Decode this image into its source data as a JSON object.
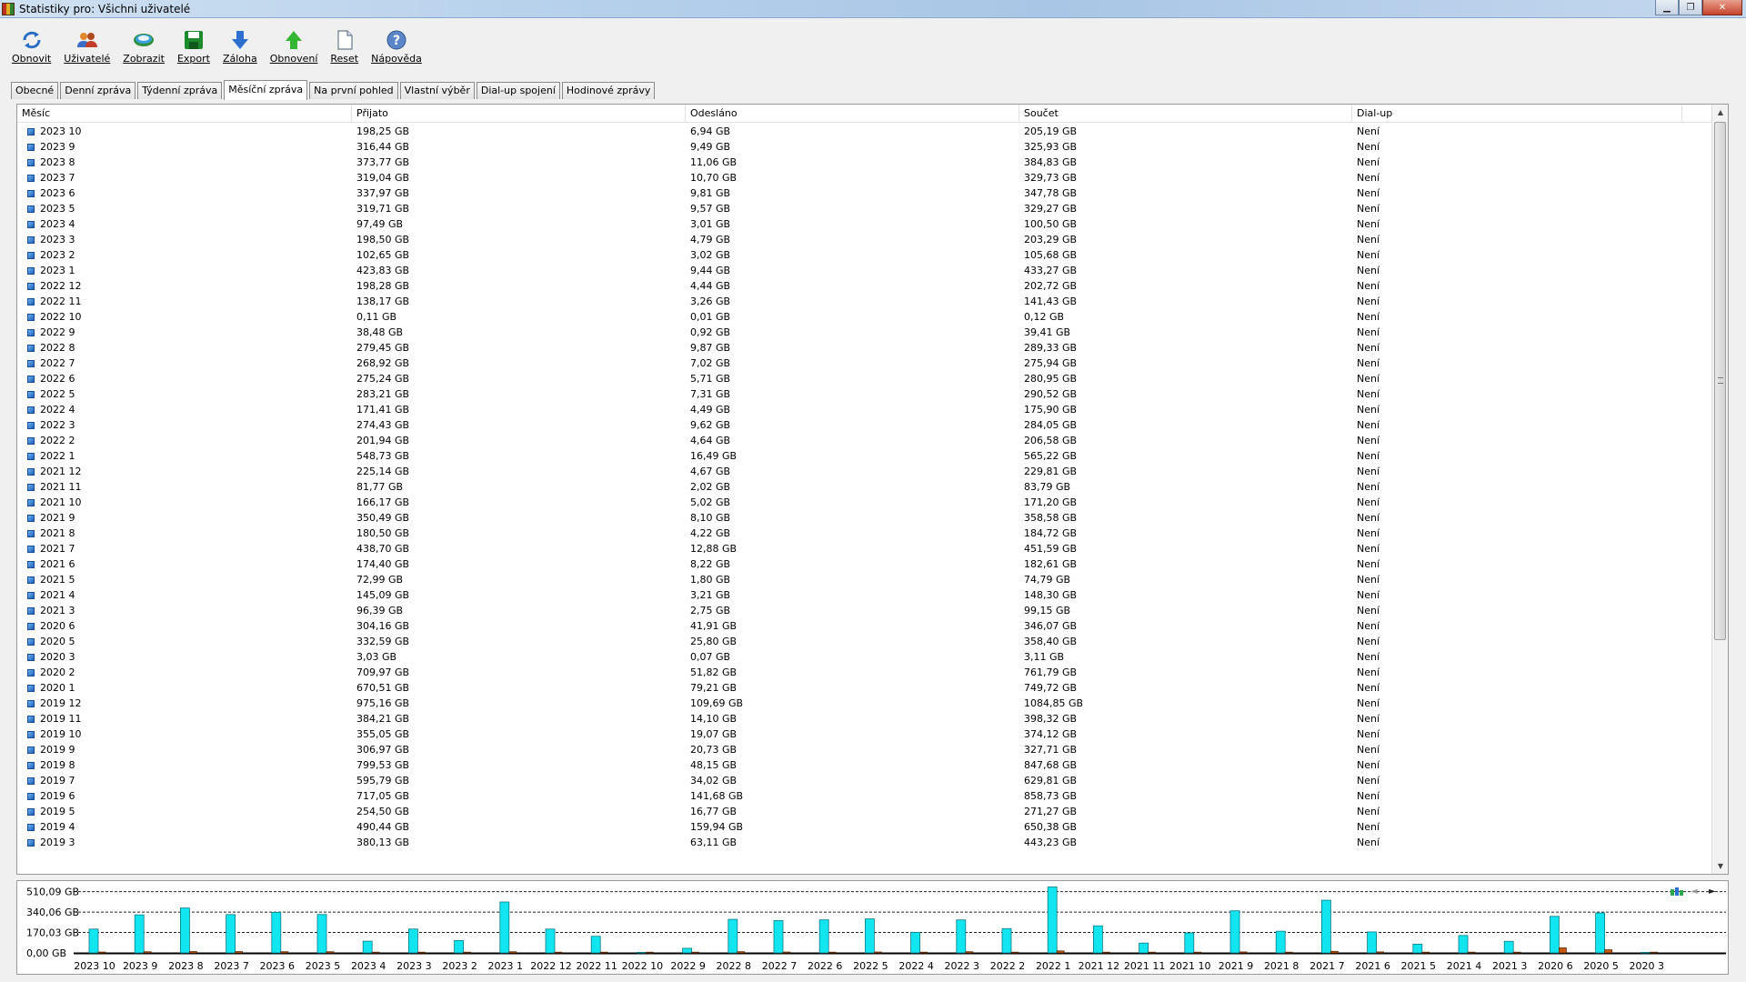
{
  "window": {
    "title": "Statistiky pro: Všichni uživatelé"
  },
  "toolbar": [
    {
      "label": "Obnovit",
      "icon": "refresh-icon"
    },
    {
      "label": "Uživatelé",
      "icon": "users-icon"
    },
    {
      "label": "Zobrazit",
      "icon": "view-icon"
    },
    {
      "label": "Export",
      "icon": "save-icon"
    },
    {
      "label": "Záloha",
      "icon": "arrow-down-icon"
    },
    {
      "label": "Obnovení",
      "icon": "arrow-up-icon"
    },
    {
      "label": "Reset",
      "icon": "page-icon"
    },
    {
      "label": "Nápověda",
      "icon": "help-icon"
    }
  ],
  "tabs": [
    {
      "label": "Obecné",
      "active": false
    },
    {
      "label": "Denní zpráva",
      "active": false
    },
    {
      "label": "Týdenní zpráva",
      "active": false
    },
    {
      "label": "Měsíční zpráva",
      "active": true
    },
    {
      "label": "Na první pohled",
      "active": false
    },
    {
      "label": "Vlastní výběr",
      "active": false
    },
    {
      "label": "Dial-up spojení",
      "active": false
    },
    {
      "label": "Hodinové zprávy",
      "active": false
    }
  ],
  "table": {
    "columns": [
      "Měsíc",
      "Přijato",
      "Odesláno",
      "Součet",
      "Dial-up"
    ],
    "rows": [
      [
        "2023 10",
        "198,25 GB",
        "6,94 GB",
        "205,19 GB",
        "Není"
      ],
      [
        "2023 9",
        "316,44 GB",
        "9,49 GB",
        "325,93 GB",
        "Není"
      ],
      [
        "2023 8",
        "373,77 GB",
        "11,06 GB",
        "384,83 GB",
        "Není"
      ],
      [
        "2023 7",
        "319,04 GB",
        "10,70 GB",
        "329,73 GB",
        "Není"
      ],
      [
        "2023 6",
        "337,97 GB",
        "9,81 GB",
        "347,78 GB",
        "Není"
      ],
      [
        "2023 5",
        "319,71 GB",
        "9,57 GB",
        "329,27 GB",
        "Není"
      ],
      [
        "2023 4",
        "97,49 GB",
        "3,01 GB",
        "100,50 GB",
        "Není"
      ],
      [
        "2023 3",
        "198,50 GB",
        "4,79 GB",
        "203,29 GB",
        "Není"
      ],
      [
        "2023 2",
        "102,65 GB",
        "3,02 GB",
        "105,68 GB",
        "Není"
      ],
      [
        "2023 1",
        "423,83 GB",
        "9,44 GB",
        "433,27 GB",
        "Není"
      ],
      [
        "2022 12",
        "198,28 GB",
        "4,44 GB",
        "202,72 GB",
        "Není"
      ],
      [
        "2022 11",
        "138,17 GB",
        "3,26 GB",
        "141,43 GB",
        "Není"
      ],
      [
        "2022 10",
        "0,11 GB",
        "0,01 GB",
        "0,12 GB",
        "Není"
      ],
      [
        "2022 9",
        "38,48 GB",
        "0,92 GB",
        "39,41 GB",
        "Není"
      ],
      [
        "2022 8",
        "279,45 GB",
        "9,87 GB",
        "289,33 GB",
        "Není"
      ],
      [
        "2022 7",
        "268,92 GB",
        "7,02 GB",
        "275,94 GB",
        "Není"
      ],
      [
        "2022 6",
        "275,24 GB",
        "5,71 GB",
        "280,95 GB",
        "Není"
      ],
      [
        "2022 5",
        "283,21 GB",
        "7,31 GB",
        "290,52 GB",
        "Není"
      ],
      [
        "2022 4",
        "171,41 GB",
        "4,49 GB",
        "175,90 GB",
        "Není"
      ],
      [
        "2022 3",
        "274,43 GB",
        "9,62 GB",
        "284,05 GB",
        "Není"
      ],
      [
        "2022 2",
        "201,94 GB",
        "4,64 GB",
        "206,58 GB",
        "Není"
      ],
      [
        "2022 1",
        "548,73 GB",
        "16,49 GB",
        "565,22 GB",
        "Není"
      ],
      [
        "2021 12",
        "225,14 GB",
        "4,67 GB",
        "229,81 GB",
        "Není"
      ],
      [
        "2021 11",
        "81,77 GB",
        "2,02 GB",
        "83,79 GB",
        "Není"
      ],
      [
        "2021 10",
        "166,17 GB",
        "5,02 GB",
        "171,20 GB",
        "Není"
      ],
      [
        "2021 9",
        "350,49 GB",
        "8,10 GB",
        "358,58 GB",
        "Není"
      ],
      [
        "2021 8",
        "180,50 GB",
        "4,22 GB",
        "184,72 GB",
        "Není"
      ],
      [
        "2021 7",
        "438,70 GB",
        "12,88 GB",
        "451,59 GB",
        "Není"
      ],
      [
        "2021 6",
        "174,40 GB",
        "8,22 GB",
        "182,61 GB",
        "Není"
      ],
      [
        "2021 5",
        "72,99 GB",
        "1,80 GB",
        "74,79 GB",
        "Není"
      ],
      [
        "2021 4",
        "145,09 GB",
        "3,21 GB",
        "148,30 GB",
        "Není"
      ],
      [
        "2021 3",
        "96,39 GB",
        "2,75 GB",
        "99,15 GB",
        "Není"
      ],
      [
        "2020 6",
        "304,16 GB",
        "41,91 GB",
        "346,07 GB",
        "Není"
      ],
      [
        "2020 5",
        "332,59 GB",
        "25,80 GB",
        "358,40 GB",
        "Není"
      ],
      [
        "2020 3",
        "3,03 GB",
        "0,07 GB",
        "3,11 GB",
        "Není"
      ],
      [
        "2020 2",
        "709,97 GB",
        "51,82 GB",
        "761,79 GB",
        "Není"
      ],
      [
        "2020 1",
        "670,51 GB",
        "79,21 GB",
        "749,72 GB",
        "Není"
      ],
      [
        "2019 12",
        "975,16 GB",
        "109,69 GB",
        "1084,85 GB",
        "Není"
      ],
      [
        "2019 11",
        "384,21 GB",
        "14,10 GB",
        "398,32 GB",
        "Není"
      ],
      [
        "2019 10",
        "355,05 GB",
        "19,07 GB",
        "374,12 GB",
        "Není"
      ],
      [
        "2019 9",
        "306,97 GB",
        "20,73 GB",
        "327,71 GB",
        "Není"
      ],
      [
        "2019 8",
        "799,53 GB",
        "48,15 GB",
        "847,68 GB",
        "Není"
      ],
      [
        "2019 7",
        "595,79 GB",
        "34,02 GB",
        "629,81 GB",
        "Není"
      ],
      [
        "2019 6",
        "717,05 GB",
        "141,68 GB",
        "858,73 GB",
        "Není"
      ],
      [
        "2019 5",
        "254,50 GB",
        "16,77 GB",
        "271,27 GB",
        "Není"
      ],
      [
        "2019 4",
        "490,44 GB",
        "159,94 GB",
        "650,38 GB",
        "Není"
      ],
      [
        "2019 3",
        "380,13 GB",
        "63,11 GB",
        "443,23 GB",
        "Není"
      ]
    ]
  },
  "chart": {
    "y_ticks": [
      {
        "label": "510,09 GB",
        "value": 510.09
      },
      {
        "label": "340,06 GB",
        "value": 340.06
      },
      {
        "label": "170,03 GB",
        "value": 170.03
      },
      {
        "label": "0,00 GB",
        "value": 0
      }
    ],
    "y_max": 560,
    "categories": [
      "2023 10",
      "2023 9",
      "2023 8",
      "2023 7",
      "2023 6",
      "2023 5",
      "2023 4",
      "2023 3",
      "2023 2",
      "2023 1",
      "2022 12",
      "2022 11",
      "2022 10",
      "2022 9",
      "2022 8",
      "2022 7",
      "2022 6",
      "2022 5",
      "2022 4",
      "2022 3",
      "2022 2",
      "2022 1",
      "2021 12",
      "2021 11",
      "2021 10",
      "2021 9",
      "2021 8",
      "2021 7",
      "2021 6",
      "2021 5",
      "2021 4",
      "2021 3",
      "2020 6",
      "2020 5",
      "2020 3"
    ],
    "received": [
      198.25,
      316.44,
      373.77,
      319.04,
      337.97,
      319.71,
      97.49,
      198.5,
      102.65,
      423.83,
      198.28,
      138.17,
      0.11,
      38.48,
      279.45,
      268.92,
      275.24,
      283.21,
      171.41,
      274.43,
      201.94,
      548.73,
      225.14,
      81.77,
      166.17,
      350.49,
      180.5,
      438.7,
      174.4,
      72.99,
      145.09,
      96.39,
      304.16,
      332.59,
      3.03
    ],
    "sent": [
      6.94,
      9.49,
      11.06,
      10.7,
      9.81,
      9.57,
      3.01,
      4.79,
      3.02,
      9.44,
      4.44,
      3.26,
      0.01,
      0.92,
      9.87,
      7.02,
      5.71,
      7.31,
      4.49,
      9.62,
      4.64,
      16.49,
      4.67,
      2.02,
      5.02,
      8.1,
      4.22,
      12.88,
      8.22,
      1.8,
      3.21,
      2.75,
      41.91,
      25.8,
      0.07
    ],
    "colors": {
      "received": "#11e5f0",
      "received_stroke": "#0a7a86",
      "sent": "#c85a10",
      "sent_stroke": "#5a2a06"
    },
    "controls": {
      "prev": "◄",
      "next": "►"
    }
  }
}
